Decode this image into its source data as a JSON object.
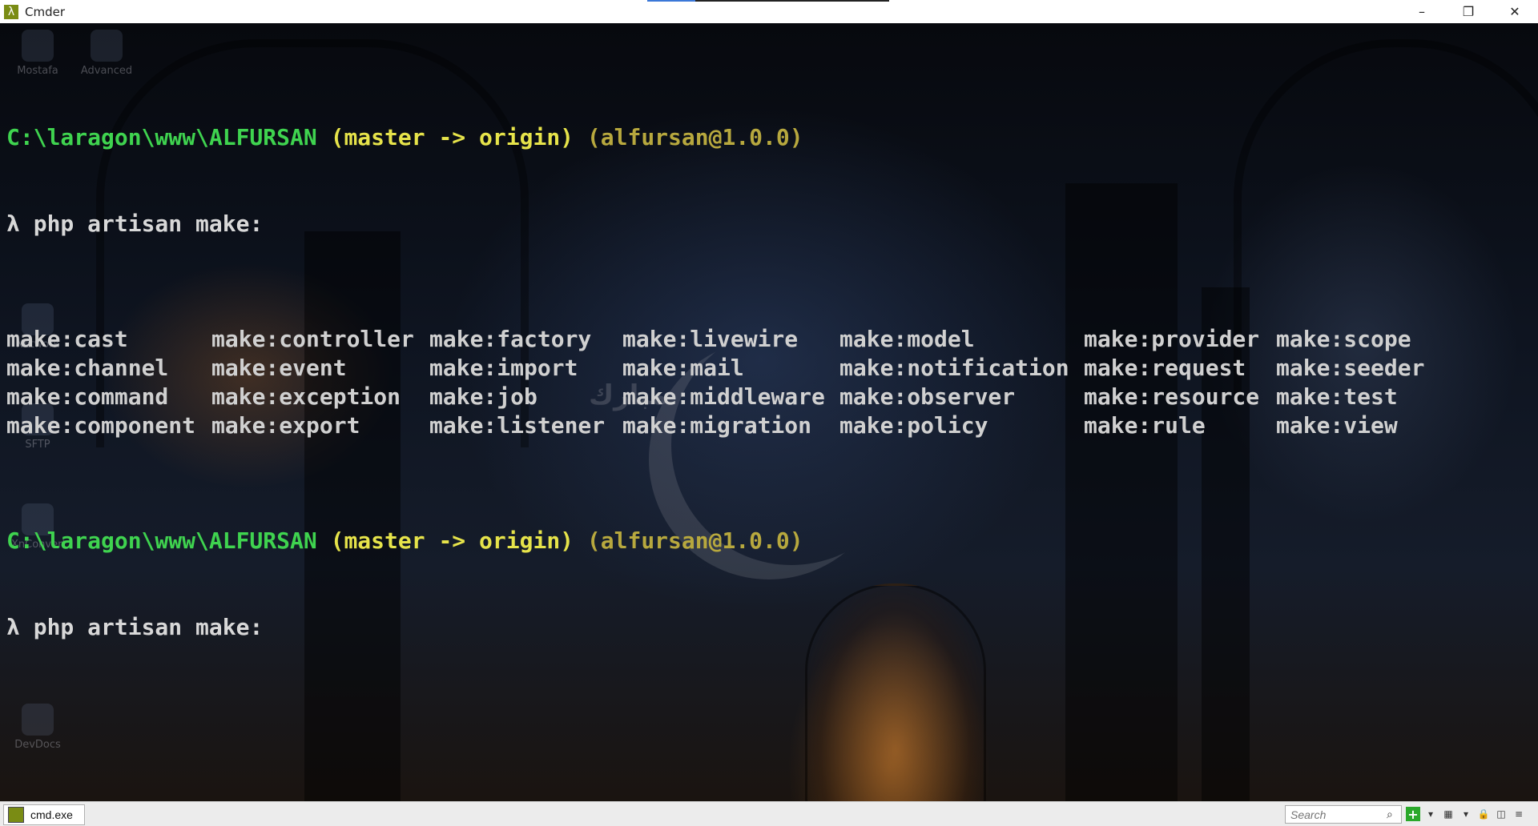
{
  "window": {
    "title": "Cmder",
    "app_icon_glyph": "λ",
    "controls": {
      "minimize": "–",
      "restore": "❐",
      "close": "✕"
    }
  },
  "wallpaper": {
    "watermark_text": "مبارك",
    "desktop_icons": [
      "Mostafa",
      "Advanced",
      "Network",
      "SFTP",
      "XnConvert",
      "DevDocs"
    ]
  },
  "terminal": {
    "prompt1": {
      "path": "C:\\laragon\\www\\ALFURSAN",
      "branch": "(master -> origin)",
      "package": "(alfursan@1.0.0)"
    },
    "command1": {
      "lambda": "λ",
      "text": "php artisan make:"
    },
    "completions": [
      [
        "make:cast",
        "make:controller",
        "make:factory",
        "make:livewire",
        "make:model",
        "make:provider",
        "make:scope"
      ],
      [
        "make:channel",
        "make:event",
        "make:import",
        "make:mail",
        "make:notification",
        "make:request",
        "make:seeder"
      ],
      [
        "make:command",
        "make:exception",
        "make:job",
        "make:middleware",
        "make:observer",
        "make:resource",
        "make:test"
      ],
      [
        "make:component",
        "make:export",
        "make:listener",
        "make:migration",
        "make:policy",
        "make:rule",
        "make:view"
      ]
    ],
    "prompt2": {
      "path": "C:\\laragon\\www\\ALFURSAN",
      "branch": "(master -> origin)",
      "package": "(alfursan@1.0.0)"
    },
    "command2": {
      "lambda": "λ",
      "text": "php artisan make:"
    }
  },
  "statusbar": {
    "tab_label": "cmd.exe",
    "search_placeholder": "Search",
    "icons": [
      "search-icon",
      "new-console-plus-icon",
      "dropdown-arrow-icon",
      "window-layout-icon",
      "lock-icon",
      "split-icon",
      "menu-icon"
    ]
  },
  "colors": {
    "path": "#3fd34f",
    "branch": "#e6e34a",
    "package": "#b7a83e",
    "text": "#d8d8d8"
  }
}
